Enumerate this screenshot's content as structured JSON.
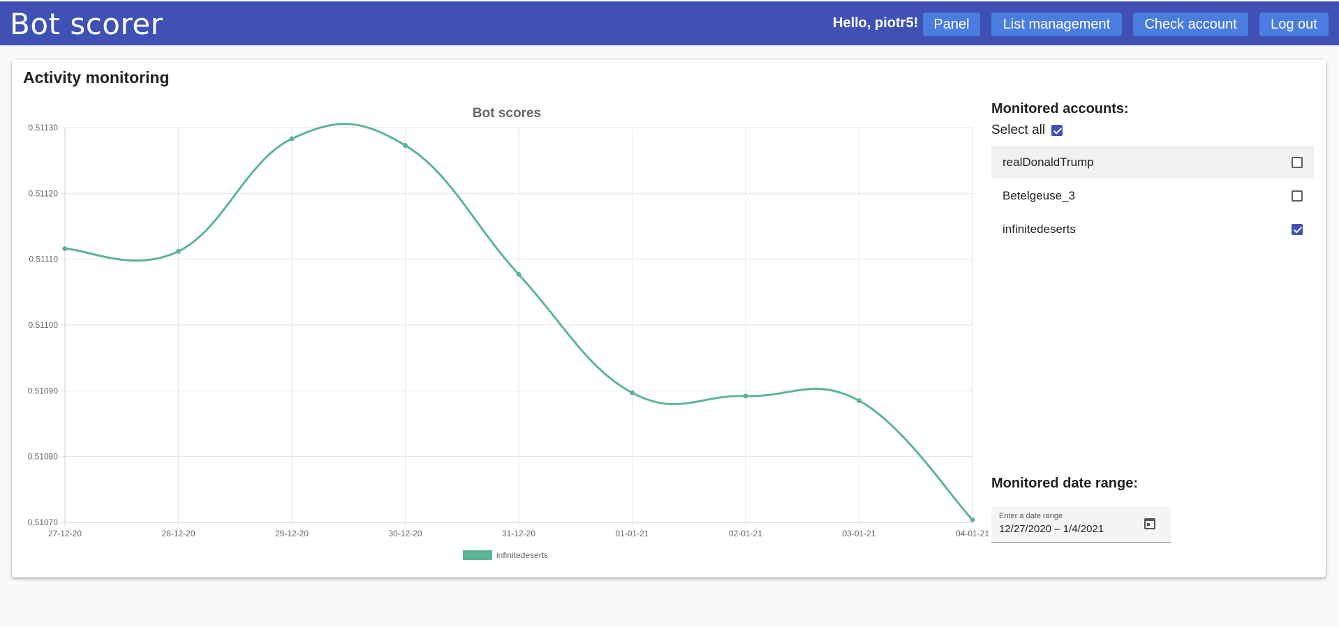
{
  "app": {
    "title": "Bot scorer"
  },
  "nav": {
    "greeting": "Hello, piotr5!",
    "buttons": [
      "Panel",
      "List management",
      "Check account",
      "Log out"
    ]
  },
  "card": {
    "title": "Activity monitoring"
  },
  "sidebar": {
    "accounts_heading": "Monitored accounts:",
    "select_all_label": "Select all",
    "select_all_checked": true,
    "accounts": [
      {
        "name": "realDonaldTrump",
        "checked": false,
        "highlighted": true
      },
      {
        "name": "Betelgeuse_3",
        "checked": false,
        "highlighted": false
      },
      {
        "name": "infinitedeserts",
        "checked": true,
        "highlighted": false
      }
    ],
    "date_heading": "Monitored date range:",
    "date_field_label": "Enter a date range",
    "date_field_value": "12/27/2020 – 1/4/2021",
    "calendar_icon": "calendar-icon"
  },
  "colors": {
    "primary": "#3f51b5",
    "nav_button": "#4b7de0",
    "series": "#5db595"
  },
  "chart_data": {
    "type": "line",
    "title": "Bot scores",
    "categories": [
      "27-12-20",
      "28-12-20",
      "29-12-20",
      "30-12-20",
      "31-12-20",
      "01-01-21",
      "02-01-21",
      "03-01-21",
      "04-01-21"
    ],
    "yticks": [
      "0.51070",
      "0.51080",
      "0.51090",
      "0.51100",
      "0.51110",
      "0.51120",
      "0.51130"
    ],
    "ylim": [
      0.5107,
      0.5113
    ],
    "grid": true,
    "legend_position": "bottom",
    "series": [
      {
        "name": "infinitedeserts",
        "values": [
          0.511116,
          0.511112,
          0.511283,
          0.511273,
          0.511077,
          0.510897,
          0.510892,
          0.510885,
          0.510704
        ]
      }
    ]
  }
}
